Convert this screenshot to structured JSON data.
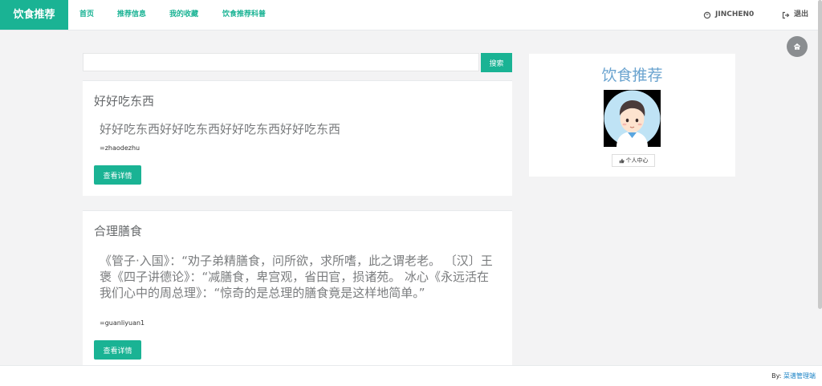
{
  "navbar": {
    "brand": "饮食推荐",
    "links": [
      "首页",
      "推荐信息",
      "我的收藏",
      "饮食推荐科普"
    ],
    "username": "JINCHEN0",
    "logout": "退出"
  },
  "search": {
    "placeholder": "",
    "button": "搜索"
  },
  "posts": [
    {
      "title": "好好吃东西",
      "content": "好好吃东西好好吃东西好好吃东西好好吃东西",
      "author": "=zhaodezhu",
      "button": "查看详情"
    },
    {
      "title": "合理膳食",
      "content": "《管子·入国》：“劝子弟精膳食，问所欲，求所嗜，此之谓老老。 〔汉〕王褒《四子讲德论》：“减膳食，卑宫观，省田官，损诸苑。 冰心《永远活在我们心中的周总理》：“惊奇的是总理的膳食竟是这样地简单。”",
      "author": "=guanliyuan1",
      "button": "查看详情"
    }
  ],
  "profile": {
    "title": "饮食推荐",
    "center_button": "个人中心"
  },
  "footer": {
    "prefix": "By:",
    "link": "菜谱管理端"
  },
  "colors": {
    "accent": "#1ab394",
    "title_blue": "#6aa3cf",
    "background": "#f3f3f4"
  },
  "icons": [
    "user-icon",
    "logout-icon",
    "home-icon",
    "thumbs-up-icon",
    "avatar-illustration"
  ]
}
